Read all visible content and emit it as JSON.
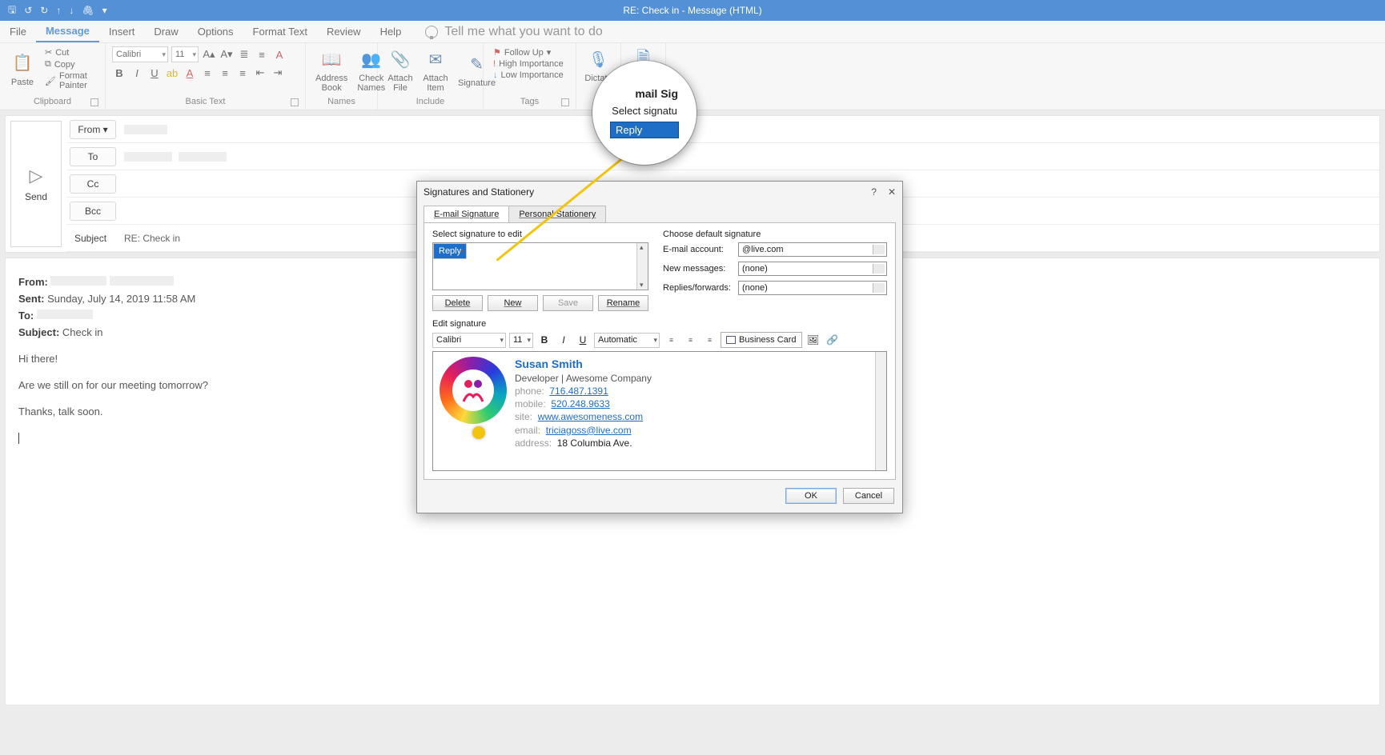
{
  "titlebar": {
    "text": "RE: Check in  -  Message (HTML)"
  },
  "menu": {
    "file": "File",
    "message": "Message",
    "insert": "Insert",
    "draw": "Draw",
    "options": "Options",
    "format": "Format Text",
    "review": "Review",
    "help": "Help",
    "tellme": "Tell me what you want to do"
  },
  "ribbon": {
    "clipboard": {
      "paste": "Paste",
      "cut": "Cut",
      "copy": "Copy",
      "fp": "Format Painter",
      "label": "Clipboard"
    },
    "basictext": {
      "font": "Calibri",
      "size": "11",
      "label": "Basic Text"
    },
    "names": {
      "ab": "Address\nBook",
      "cn": "Check\nNames",
      "label": "Names"
    },
    "include": {
      "af": "Attach\nFile",
      "ai": "Attach\nItem",
      "sig": "Signature",
      "label": "Include"
    },
    "tags": {
      "fu": "Follow Up",
      "hi": "High Importance",
      "lo": "Low Importance",
      "label": "Tags"
    },
    "dictate": "Dictate"
  },
  "compose": {
    "send": "Send",
    "from": "From",
    "to": "To",
    "cc": "Cc",
    "bcc": "Bcc",
    "subject_label": "Subject",
    "subject_value": "RE: Check in"
  },
  "body": {
    "from_lbl": "From:",
    "sent_lbl": "Sent:",
    "sent_val": "Sunday, July 14, 2019 11:58 AM",
    "to_lbl": "To:",
    "subject_lbl": "Subject:",
    "subject_val": "Check in",
    "l1": "Hi there!",
    "l2": "Are we still on for our meeting tomorrow?",
    "l3": "Thanks, talk soon."
  },
  "dialog": {
    "title": "Signatures and Stationery",
    "tab1": "E-mail Signature",
    "tab2": "Personal Stationery",
    "select_sig": "Select signature to edit",
    "reply_item": "Reply",
    "choose_def": "Choose default signature",
    "email_acc": "E-mail account:",
    "email_acc_val": "@live.com",
    "new_msg": "New messages:",
    "new_msg_val": "(none)",
    "rep_fwd": "Replies/forwards:",
    "rep_fwd_val": "(none)",
    "delete": "Delete",
    "new": "New",
    "save": "Save",
    "rename": "Rename",
    "edit_sig": "Edit signature",
    "sigfont": "Calibri",
    "sigsize": "11",
    "sigcolor": "Automatic",
    "bizcard": "Business Card",
    "sig_name": "Susan Smith",
    "sig_role": "Developer | Awesome Company",
    "sig_phone_k": "phone:",
    "sig_phone_v": "716.487.1391",
    "sig_mobile_k": "mobile:",
    "sig_mobile_v": "520.248.9633",
    "sig_site_k": "site:",
    "sig_site_v": "www.awesomeness.com",
    "sig_email_k": "email:",
    "sig_email_v": "triciagoss@live.com",
    "sig_addr_k": "address:",
    "sig_addr_v": "18 Columbia Ave.",
    "ok": "OK",
    "cancel": "Cancel"
  },
  "zoom": {
    "t1": "mail Sig",
    "t2": "Select signatu",
    "item": "Reply"
  }
}
